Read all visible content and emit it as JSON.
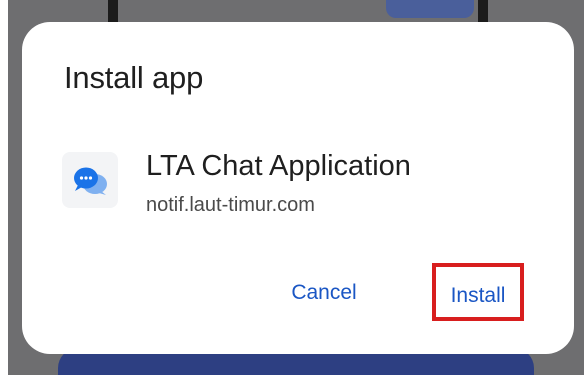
{
  "dialog": {
    "title": "Install app",
    "app_name": "LTA Chat Application",
    "app_origin": "notif.laut-timur.com",
    "app_icon": "chat-bubbles-icon",
    "cancel_label": "Cancel",
    "install_label": "Install"
  },
  "colors": {
    "accent": "#1a56c4",
    "highlight_box": "#d81e1e",
    "scrim": "#6e6e70",
    "dialog_bg": "#ffffff"
  }
}
